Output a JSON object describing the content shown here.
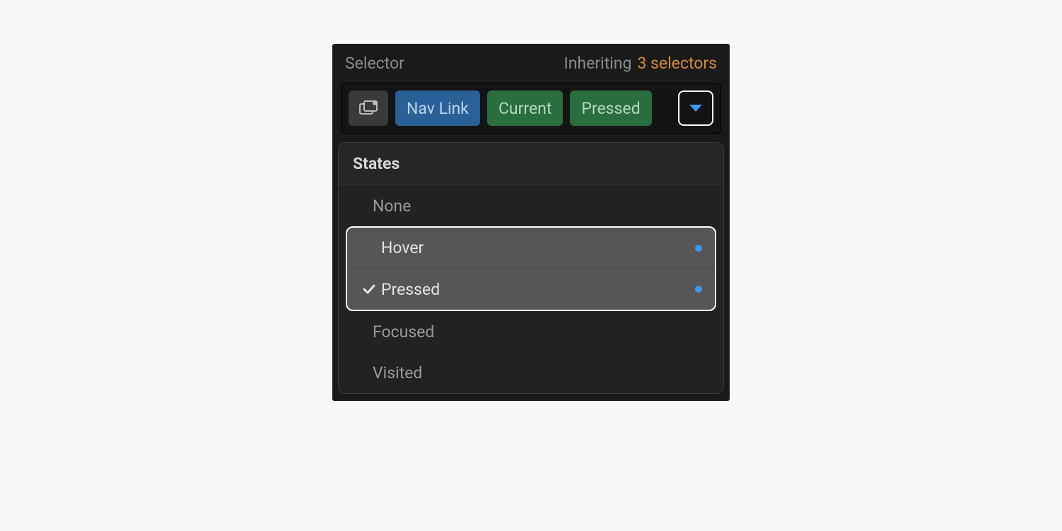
{
  "header": {
    "title": "Selector",
    "inheriting_label": "Inheriting",
    "selectors_link": "3 selectors"
  },
  "selector_chips": {
    "icon_name": "element-icon",
    "nav_link": "Nav Link",
    "current": "Current",
    "pressed": "Pressed"
  },
  "states": {
    "heading": "States",
    "items": [
      {
        "label": "None",
        "checked": false,
        "has_dot": false,
        "highlighted": false
      },
      {
        "label": "Hover",
        "checked": false,
        "has_dot": true,
        "highlighted": true
      },
      {
        "label": "Pressed",
        "checked": true,
        "has_dot": true,
        "highlighted": true
      },
      {
        "label": "Focused",
        "checked": false,
        "has_dot": false,
        "highlighted": false
      },
      {
        "label": "Visited",
        "checked": false,
        "has_dot": false,
        "highlighted": false
      }
    ]
  },
  "colors": {
    "accent_blue": "#3b99e8",
    "chip_green": "#2a6d3f",
    "chip_blue": "#2a6098",
    "link_orange": "#d48938"
  }
}
